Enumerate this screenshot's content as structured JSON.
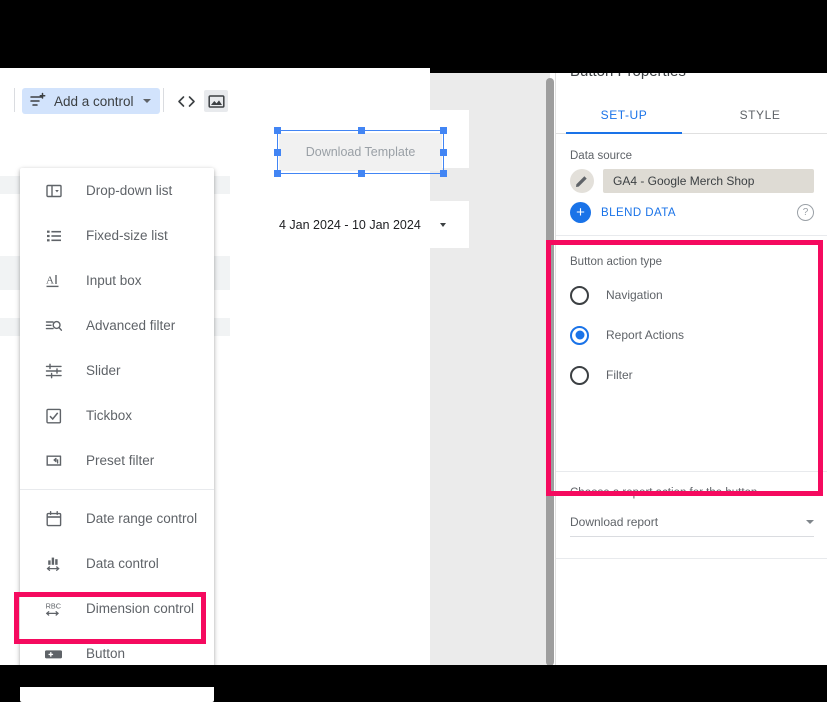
{
  "theme": {
    "pink_highlight": "#f50a5f",
    "accent_blue": "#1a73e8",
    "selection_blue": "#4285f4",
    "toolbar_chip_bg": "#d2e3fc"
  },
  "toolbar": {
    "add_control_label": "Add a control",
    "add_control_icon": "add-control-icon",
    "embed_icon": "embed-code-icon",
    "image_icon": "image-icon"
  },
  "control_menu": {
    "items": [
      {
        "label": "Drop-down list",
        "icon": "drop-down-list-icon"
      },
      {
        "label": "Fixed-size list",
        "icon": "fixed-size-list-icon"
      },
      {
        "label": "Input box",
        "icon": "input-box-icon"
      },
      {
        "label": "Advanced filter",
        "icon": "advanced-filter-icon"
      },
      {
        "label": "Slider",
        "icon": "slider-icon"
      },
      {
        "label": "Tickbox",
        "icon": "tickbox-icon"
      },
      {
        "label": "Preset filter",
        "icon": "preset-filter-icon"
      },
      {
        "label": "Date range control",
        "icon": "calendar-icon"
      },
      {
        "label": "Data control",
        "icon": "data-control-icon"
      },
      {
        "label": "Dimension control",
        "icon": "dimension-control-icon"
      },
      {
        "label": "Button",
        "icon": "button-icon"
      }
    ],
    "divider_after_index": 6,
    "highlighted_item": "Button"
  },
  "canvas": {
    "button_widget_label": "Download Template",
    "date_range_value": "4 Jan 2024 - 10 Jan 2024"
  },
  "properties_panel": {
    "title": "Button Properties",
    "tabs": [
      {
        "label": "SET-UP",
        "active": true
      },
      {
        "label": "STYLE",
        "active": false
      }
    ],
    "data_source": {
      "section_label": "Data source",
      "name": "GA4 - Google Merch Shop",
      "edit_icon": "pencil-icon",
      "blend_label": "BLEND DATA",
      "blend_icon": "plus-circle-icon",
      "help_icon": "help-icon"
    },
    "button_action_type": {
      "section_label": "Button action type",
      "options": [
        {
          "label": "Navigation",
          "selected": false
        },
        {
          "label": "Report Actions",
          "selected": true
        },
        {
          "label": "Filter",
          "selected": false
        }
      ]
    },
    "report_action": {
      "section_label": "Choose a report action for the button",
      "selected_value": "Download report",
      "caret_icon": "chevron-down-icon"
    }
  }
}
